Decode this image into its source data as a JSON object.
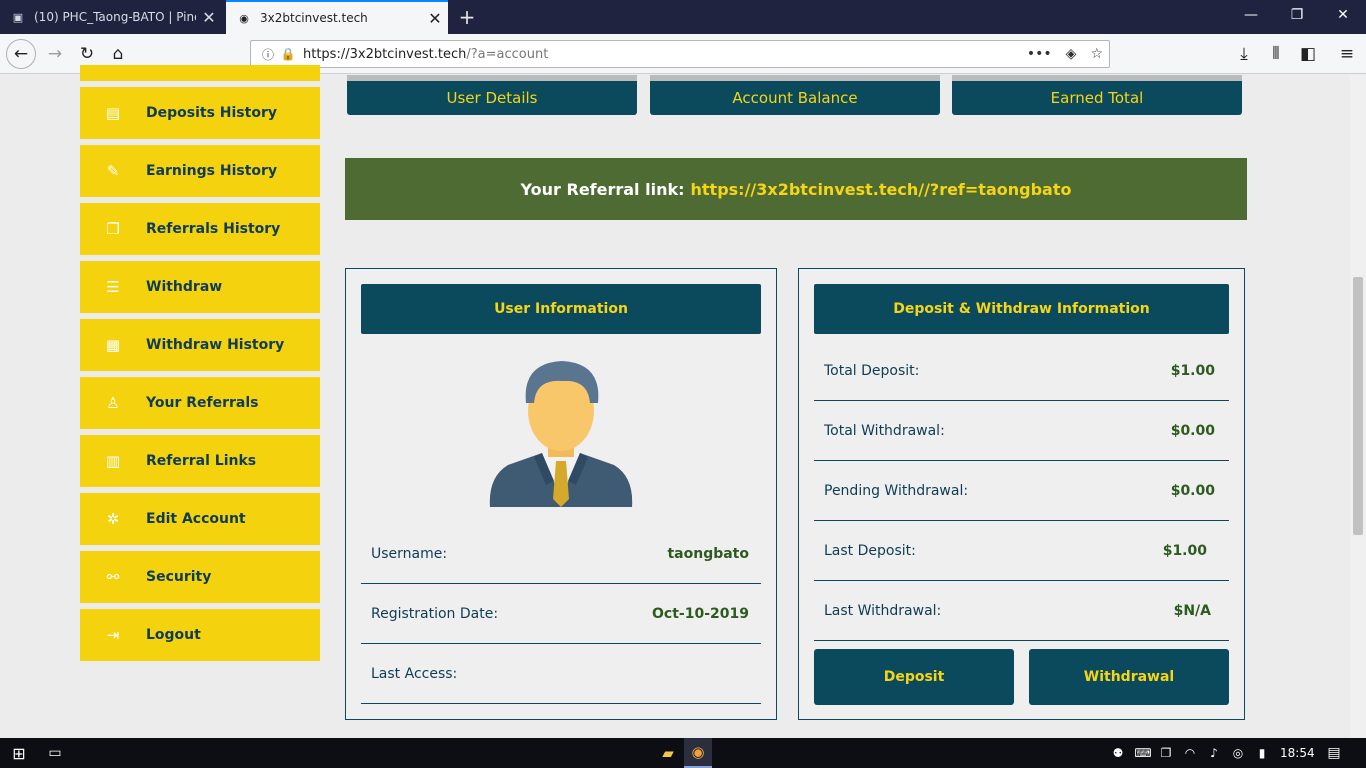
{
  "browser": {
    "tabs": [
      {
        "title": "(10) PHC_Taong-BATO | Pinoy H",
        "active": false
      },
      {
        "title": "3x2btcinvest.tech",
        "active": true
      }
    ],
    "url": {
      "host": "https://3x2btcinvest.tech",
      "path": "/?a=account"
    }
  },
  "sidebar": {
    "items": [
      {
        "label": "Deposits History",
        "icon": "receipt-icon"
      },
      {
        "label": "Earnings History",
        "icon": "edit-icon"
      },
      {
        "label": "Referrals History",
        "icon": "copy-icon"
      },
      {
        "label": "Withdraw",
        "icon": "list-icon"
      },
      {
        "label": "Withdraw History",
        "icon": "calendar-icon"
      },
      {
        "label": "Your Referrals",
        "icon": "user-icon"
      },
      {
        "label": "Referral Links",
        "icon": "grid-list-icon"
      },
      {
        "label": "Edit Account",
        "icon": "gear-icon"
      },
      {
        "label": "Security",
        "icon": "link-icon"
      },
      {
        "label": "Logout",
        "icon": "logout-icon"
      }
    ]
  },
  "top_buttons": [
    "User Details",
    "Account Balance",
    "Earned Total"
  ],
  "referral": {
    "prefix": "Your Referral link:",
    "link": "https://3x2btcinvest.tech//?ref=taongbato"
  },
  "user_info": {
    "title": "User Information",
    "rows": [
      {
        "key": "Username:",
        "value": "taongbato"
      },
      {
        "key": "Registration Date:",
        "value": "Oct-10-2019"
      },
      {
        "key": "Last Access:",
        "value": ""
      }
    ]
  },
  "deposit_info": {
    "title": "Deposit & Withdraw Information",
    "rows": [
      {
        "key": "Total Deposit:",
        "value": "$1.00"
      },
      {
        "key": "Total Withdrawal:",
        "value": "$0.00"
      },
      {
        "key": "Pending Withdrawal:",
        "value": "$0.00"
      },
      {
        "key": "Last Deposit:",
        "value": "$1.00"
      },
      {
        "key": "Last Withdrawal:",
        "value": "$N/A"
      }
    ],
    "deposit_label": "Deposit",
    "withdrawal_label": "Withdrawal"
  },
  "taskbar": {
    "time": "18:54"
  },
  "colors": {
    "sidebar_bg": "#f4d30e",
    "dark_teal": "#0b4a5c",
    "accent_yellow": "#f6d514",
    "referral_bg": "#4e6b33"
  }
}
